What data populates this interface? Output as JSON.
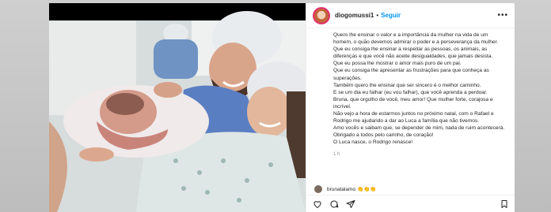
{
  "post": {
    "username": "diogomussi1",
    "separator": "•",
    "follow_label": "Seguir",
    "more_label": "•••",
    "caption_lines": [
      "Quero lhe ensinar o valor e a importância da mulher na vida de um homem, o quão devemos admirar o poder e a perseverança da mulher.",
      "Que eu consiga lhe ensinar a respeitar as pessoas, os animais, as diferenças e que você não aceite desigualdades, que jamais desista.",
      "Que eu possa lhe mostrar o amor mais puro de um pai.",
      "Que eu consiga lhe apresentar as frustrações para que conheça as superações.",
      "Também quero lhe ensinar que ser sincero é o melhor caminho.",
      "E se um dia eu falhar (eu vou falhar), que você aprenda a perdoar.",
      "Bruna, que orgulho de você, meu amor! Que mulher forte, corajosa e incrível.",
      "Não vejo a hora de estarmos juntos no próximo natal, com o Rafael e Rodrigo me ajudando a dar ao Luca a família que não tivemos.",
      "Amo vocês e saibam que, se depender de mim, nada de ruim acontecerá.",
      "Obrigado a todos pelo carinho, de coração!",
      "O Luca nasce, o Rodrigo renasce!"
    ],
    "time_ago": "1 h",
    "comment_preview": "brunatalamo 👏👏👏"
  },
  "icons": {
    "like": "heart-icon",
    "comment": "comment-icon",
    "share": "send-icon",
    "save": "bookmark-icon"
  }
}
